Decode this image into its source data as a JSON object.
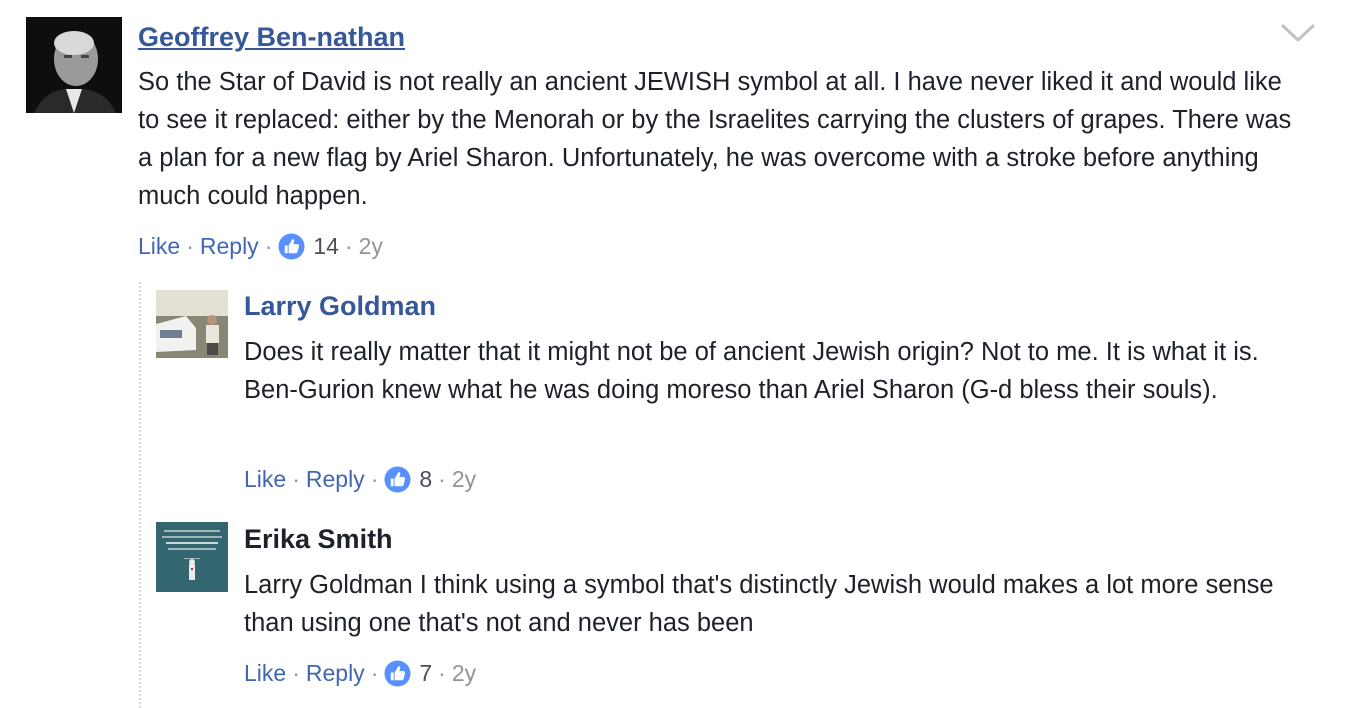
{
  "comments": [
    {
      "author": "Geoffrey Ben-nathan",
      "text": "So the Star of David is not really an ancient JEWISH symbol at all. I have never liked it and would like to see it replaced: either by the Menorah or by the Israelites carrying the clusters of grapes. There was a plan for a new flag by Ariel Sharon. Unfortunately, he was overcome with a stroke before anything much could happen.",
      "like_label": "Like",
      "reply_label": "Reply",
      "separator": "·",
      "likes": "14",
      "time": "2y"
    },
    {
      "author": "Larry Goldman",
      "text": "Does it really matter that it might not be of ancient Jewish origin? Not to me. It is what it is. Ben-Gurion knew what he was doing moreso than Ariel Sharon (G-d bless their souls).",
      "like_label": "Like",
      "reply_label": "Reply",
      "separator": "·",
      "likes": "8",
      "time": "2y"
    },
    {
      "author": "Erika Smith",
      "text": "Larry Goldman I think using a symbol that's distinctly Jewish would makes a lot more sense than using one that's not and never has been",
      "like_label": "Like",
      "reply_label": "Reply",
      "separator": "·",
      "likes": "7",
      "time": "2y"
    }
  ],
  "icons": {
    "options": "chevron-down-icon",
    "reaction": "thumbs-up-icon"
  },
  "colors": {
    "link": "#365899",
    "action": "#4267b2",
    "muted": "#90949c",
    "text": "#1d2129"
  }
}
